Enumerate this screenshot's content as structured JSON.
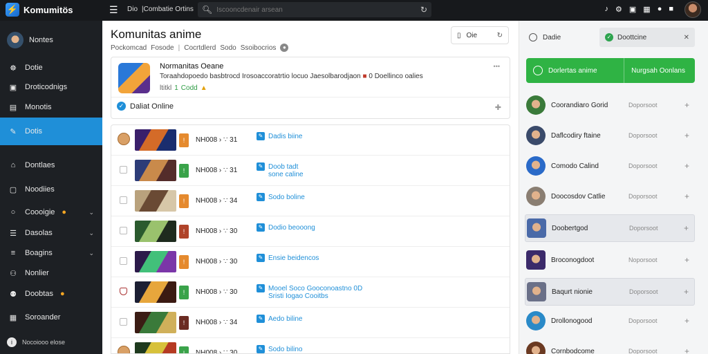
{
  "topbar": {
    "logo_text": "Komumitös",
    "nav": [
      "Dio",
      "|Combatie Ortins"
    ],
    "search_placeholder": "Iscooncdenair arsean",
    "icons": [
      "bell-icon",
      "settings-icon",
      "chat-icon",
      "grid-icon",
      "notification-icon",
      "mail-icon"
    ]
  },
  "sidebar": {
    "user_name": "Nontes",
    "items": [
      {
        "label": "Dotie",
        "icon": "person-icon"
      },
      {
        "label": "Droticodnigs",
        "icon": "folder-icon"
      },
      {
        "label": "Monotis",
        "icon": "book-icon"
      },
      {
        "label": "Dotis",
        "icon": "edit-icon",
        "active": true
      },
      {
        "label": "Dontlaes",
        "icon": "home-icon"
      },
      {
        "label": "Noodiies",
        "icon": "message-icon"
      },
      {
        "label": "Coooigie",
        "icon": "chat-icon",
        "chevron": true,
        "badge": true
      },
      {
        "label": "Dasolas",
        "icon": "list-icon",
        "chevron": true
      },
      {
        "label": "Boagins",
        "icon": "layers-icon",
        "chevron": true
      },
      {
        "label": "Nonlier",
        "icon": "people-icon"
      },
      {
        "label": "Doobtas",
        "icon": "users-icon",
        "badge": true
      },
      {
        "label": "Soroander",
        "icon": "calendar-icon"
      }
    ],
    "footer": "Nocoiooo elose"
  },
  "main": {
    "title": "Komunitas anime",
    "breadcrumb": [
      "Pockomcad",
      "Fosode",
      "Cocrtdlerd",
      "Sodo",
      "Ssoibocrios"
    ],
    "top_action_label": "Oie",
    "card": {
      "title": "Normanitas Oeane",
      "desc": "Toraahdopoedo basbtrocd Irosoaccoratrtio locuo Jaesolbarodjaon",
      "desc_suffix": "0 Doellinco oalies",
      "meta": [
        "ltitkl",
        "1",
        "Codd"
      ],
      "footer_label": "Daliat Online"
    },
    "rows": [
      {
        "code": "NH008 › ∵ 31",
        "link": "Dadis biine",
        "tag_color": "#e58a2e",
        "check": "round",
        "thumb": [
          "#3a1f6b",
          "#d46b28",
          "#1a2d6e"
        ]
      },
      {
        "code": "NH008 › ∵ 31",
        "link": "Doob tadt\nsone caline",
        "tag_color": "#3aa34a",
        "check": "box",
        "thumb": [
          "#2d3c78",
          "#c98a4b",
          "#542c2a"
        ]
      },
      {
        "code": "NH008 › ∵ 34",
        "link": "Sodo boline",
        "tag_color": "#e58a2e",
        "check": "box",
        "thumb": [
          "#b9a27d",
          "#6a4a34",
          "#d7c7a8"
        ]
      },
      {
        "code": "NH008 › ∵ 30",
        "link": "Dodio beooong",
        "tag_color": "#b0442a",
        "check": "box",
        "thumb": [
          "#2b5a2e",
          "#9ac26d",
          "#1e2b1e"
        ]
      },
      {
        "code": "NH008 › ∵ 30",
        "link": "Ensie beidencos",
        "tag_color": "#e58a2e",
        "check": "box",
        "thumb": [
          "#2c1a4a",
          "#42c07a",
          "#7b36a8"
        ]
      },
      {
        "code": "NH008 › ∵ 30",
        "link": "Mooel Soco Gooconoastno 0D\nSristi Iogao Cooitbs",
        "tag_color": "#3aa34a",
        "check": "shield",
        "thumb": [
          "#1c1f33",
          "#e7a63c",
          "#3b1a12"
        ]
      },
      {
        "code": "NH008 › ∵ 34",
        "link": "Aedo biline",
        "tag_color": "#6b2b22",
        "check": "box",
        "thumb": [
          "#3b1c14",
          "#3a7a3a",
          "#d0b05a"
        ]
      },
      {
        "code": "NH008 › ∵ 30",
        "link": "Sodo bilino",
        "tag_color": "#3aa34a",
        "check": "round",
        "thumb": [
          "#1e3a1e",
          "#d7c13a",
          "#b53a22"
        ]
      }
    ]
  },
  "right": {
    "head_label": "Dadie",
    "status_label": "Doottcine",
    "button_left": "Dorlertas anime",
    "button_right": "Nurgsah Oonlans",
    "items": [
      {
        "name": "Coorandiaro Gorid",
        "status": "Doporsoot",
        "color": "#3a7a3a",
        "sq": false,
        "hl": false
      },
      {
        "name": "Daflcodiry ftaine",
        "status": "Doporsoot",
        "color": "#3a4a6a",
        "sq": false,
        "hl": false
      },
      {
        "name": "Comodo Calind",
        "status": "Doporsoot",
        "color": "#2a6ac8",
        "sq": false,
        "hl": false
      },
      {
        "name": "Doocosdov Catlie",
        "status": "Doporsoot",
        "color": "#8a7e72",
        "sq": false,
        "hl": false
      },
      {
        "name": "Doobertgod",
        "status": "Doporsoot",
        "color": "#4a6aa8",
        "sq": true,
        "hl": true
      },
      {
        "name": "Broconogdoot",
        "status": "Noporsoot",
        "color": "#3b2a6a",
        "sq": true,
        "hl": false
      },
      {
        "name": "Baqurt nionie",
        "status": "Doporsoot",
        "color": "#6a7088",
        "sq": true,
        "hl": true
      },
      {
        "name": "Drollonogood",
        "status": "Doporsoot",
        "color": "#2a8ac8",
        "sq": false,
        "hl": false
      },
      {
        "name": "Cornbodcome",
        "status": "Doporsoot",
        "color": "#6b3a22",
        "sq": false,
        "hl": false
      }
    ]
  }
}
